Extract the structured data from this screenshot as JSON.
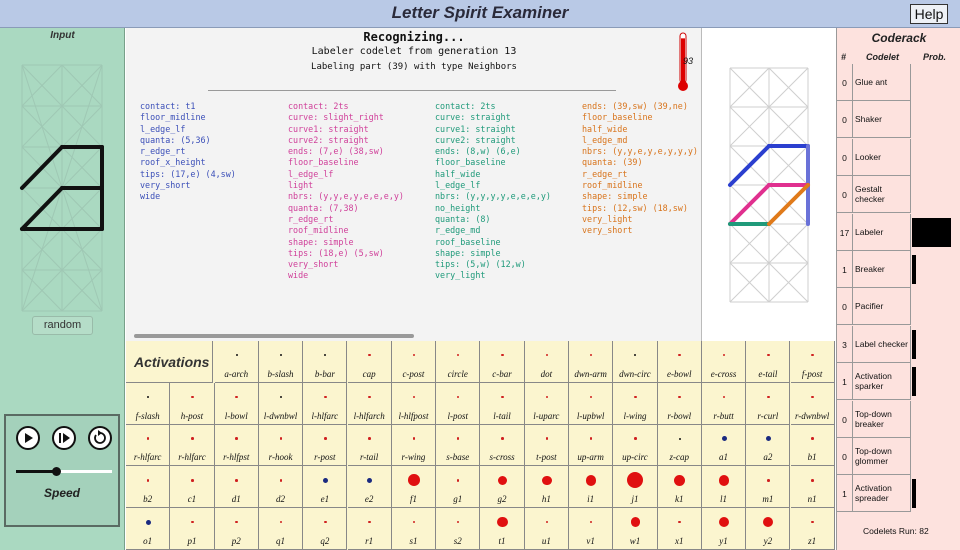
{
  "app": {
    "title": "Letter Spirit Examiner",
    "help_label": "Help"
  },
  "input_panel": {
    "header": "Input",
    "random_label": "random",
    "speed_label": "Speed",
    "speed_value": 0.42
  },
  "controls": {
    "play": "play-icon",
    "step": "step-icon",
    "reset": "reset-icon"
  },
  "recognition": {
    "title": "Recognizing...",
    "sub1": "Labeler codelet from generation 13",
    "sub2": "Labeling part (39) with type Neighbors",
    "temperature": "93",
    "temperature_level": 0.93,
    "columns": [
      {
        "color": "#3b4fb8",
        "lines": [
          "contact: t1",
          "floor_midline",
          "l_edge_lf",
          "quanta: (5,36)",
          "r_edge_rt",
          "roof_x_height",
          "tips: (17,e) (4,sw)",
          "very_short",
          "wide"
        ]
      },
      {
        "color": "#d0409a",
        "lines": [
          "contact: 2ts",
          "curve: slight_right",
          "curve1: straight",
          "curve2: straight",
          "ends: (7,e) (38,sw)",
          "floor_baseline",
          "l_edge_lf",
          "light",
          "nbrs: (y,y,e,y,e,e,e,y)",
          "quanta: (7,38)",
          "r_edge_rt",
          "roof_midline",
          "shape: simple",
          "tips: (18,e) (5,sw)",
          "very_short",
          "wide"
        ]
      },
      {
        "color": "#1f9a7a",
        "lines": [
          "contact: 2ts",
          "curve: straight",
          "curve1: straight",
          "curve2: straight",
          "ends: (8,w) (6,e)",
          "floor_baseline",
          "half_wide",
          "l_edge_lf",
          "nbrs: (y,y,y,y,e,e,e,y)",
          "no_height",
          "quanta: (8)",
          "r_edge_md",
          "roof_baseline",
          "shape: simple",
          "tips: (5,w) (12,w)",
          "very_light"
        ]
      },
      {
        "color": "#d8731a",
        "lines": [
          "ends: (39,sw) (39,ne)",
          "floor_baseline",
          "half_wide",
          "l_edge_md",
          "nbrs: (y,y,e,y,e,y,y,y)",
          "quanta: (39)",
          "r_edge_rt",
          "roof_midline",
          "shape: simple",
          "tips: (12,sw) (18,sw)",
          "very_light",
          "very_short"
        ]
      }
    ]
  },
  "activations": {
    "header": "Activations",
    "rows": [
      [
        {
          "label": "a-arch",
          "a": 0
        },
        {
          "label": "b-slash",
          "a": 0
        },
        {
          "label": "b-bar",
          "a": 0
        },
        {
          "label": "cap",
          "a": 0.1
        },
        {
          "label": "c-post",
          "a": 0.1
        },
        {
          "label": "circle",
          "a": 0.1
        },
        {
          "label": "c-bar",
          "a": 0.1
        },
        {
          "label": "dot",
          "a": 0.1
        },
        {
          "label": "dwn-arm",
          "a": 0.1
        },
        {
          "label": "dwn-circ",
          "a": 0
        },
        {
          "label": "e-bowl",
          "a": 0.1
        },
        {
          "label": "e-cross",
          "a": 0.1
        },
        {
          "label": "e-tail",
          "a": 0.1
        },
        {
          "label": "f-post",
          "a": 0.1
        }
      ],
      [
        {
          "label": "f-slash",
          "a": 0
        },
        {
          "label": "h-post",
          "a": 0.1
        },
        {
          "label": "l-bowl",
          "a": 0.1
        },
        {
          "label": "l-dwnbwl",
          "a": 0
        },
        {
          "label": "l-hlfarc",
          "a": 0.1
        },
        {
          "label": "l-hlfarch",
          "a": 0.1
        },
        {
          "label": "l-hlfpost",
          "a": 0.1
        },
        {
          "label": "l-post",
          "a": 0.1
        },
        {
          "label": "l-tail",
          "a": 0.1
        },
        {
          "label": "l-uparc",
          "a": 0.1
        },
        {
          "label": "l-upbwl",
          "a": 0.1
        },
        {
          "label": "l-wing",
          "a": 0.1
        },
        {
          "label": "r-bowl",
          "a": 0.1
        },
        {
          "label": "r-butt",
          "a": 0.1
        },
        {
          "label": "r-curl",
          "a": 0.1
        },
        {
          "label": "r-dwnbwl",
          "a": 0.1
        }
      ],
      [
        {
          "label": "r-hlfarc",
          "a": 0.1
        },
        {
          "label": "r-hlfarc",
          "a": 0.1
        },
        {
          "label": "r-hlfpst",
          "a": 0.1
        },
        {
          "label": "r-hook",
          "a": 0.1
        },
        {
          "label": "r-post",
          "a": 0.1
        },
        {
          "label": "r-tail",
          "a": 0.1
        },
        {
          "label": "r-wing",
          "a": 0.1
        },
        {
          "label": "s-base",
          "a": 0.1
        },
        {
          "label": "s-cross",
          "a": 0.1
        },
        {
          "label": "t-post",
          "a": 0.1
        },
        {
          "label": "up-arm",
          "a": 0.1
        },
        {
          "label": "up-circ",
          "a": 0.1
        },
        {
          "label": "z-cap",
          "a": 0
        },
        {
          "label": "a1",
          "a": 0.4
        },
        {
          "label": "a2",
          "a": 0.4
        },
        {
          "label": "b1",
          "a": 0.1
        }
      ],
      [
        {
          "label": "b2",
          "a": 0.1
        },
        {
          "label": "c1",
          "a": 0.1
        },
        {
          "label": "d1",
          "a": 0.1
        },
        {
          "label": "d2",
          "a": 0.1
        },
        {
          "label": "e1",
          "a": 0.4
        },
        {
          "label": "e2",
          "a": 0.4
        },
        {
          "label": "f1",
          "a": 0.65
        },
        {
          "label": "g1",
          "a": 0.1
        },
        {
          "label": "g2",
          "a": 0.45
        },
        {
          "label": "h1",
          "a": 0.45
        },
        {
          "label": "i1",
          "a": 0.55
        },
        {
          "label": "j1",
          "a": 1.0
        },
        {
          "label": "k1",
          "a": 0.6
        },
        {
          "label": "l1",
          "a": 0.55
        },
        {
          "label": "m1",
          "a": 0.1
        },
        {
          "label": "n1",
          "a": 0.1
        }
      ],
      [
        {
          "label": "o1",
          "a": 0.4
        },
        {
          "label": "p1",
          "a": 0.1
        },
        {
          "label": "p2",
          "a": 0.1
        },
        {
          "label": "q1",
          "a": 0.1
        },
        {
          "label": "q2",
          "a": 0.1
        },
        {
          "label": "r1",
          "a": 0.1
        },
        {
          "label": "s1",
          "a": 0.1
        },
        {
          "label": "s2",
          "a": 0.1
        },
        {
          "label": "t1",
          "a": 0.55
        },
        {
          "label": "u1",
          "a": 0.1
        },
        {
          "label": "v1",
          "a": 0.1
        },
        {
          "label": "w1",
          "a": 0.45
        },
        {
          "label": "x1",
          "a": 0.1
        },
        {
          "label": "y1",
          "a": 0.5
        },
        {
          "label": "y2",
          "a": 0.5
        },
        {
          "label": "z1",
          "a": 0.1
        }
      ]
    ]
  },
  "coderack": {
    "title": "Coderack",
    "col_num": "#",
    "col_codelet": "Codelet",
    "col_prob": "Prob.",
    "rows": [
      {
        "n": "0",
        "name": "Glue ant",
        "prob": 0
      },
      {
        "n": "0",
        "name": "Shaker",
        "prob": 0
      },
      {
        "n": "0",
        "name": "Looker",
        "prob": 0
      },
      {
        "n": "0",
        "name": "Gestalt checker",
        "prob": 0
      },
      {
        "n": "17",
        "name": "Labeler",
        "prob": 1.0
      },
      {
        "n": "1",
        "name": "Breaker",
        "prob": 0.1
      },
      {
        "n": "0",
        "name": "Pacifier",
        "prob": 0
      },
      {
        "n": "3",
        "name": "Label checker",
        "prob": 0.18
      },
      {
        "n": "1",
        "name": "Activation sparker",
        "prob": 0.1
      },
      {
        "n": "0",
        "name": "Top-down breaker",
        "prob": 0
      },
      {
        "n": "0",
        "name": "Top-down glommer",
        "prob": 0
      },
      {
        "n": "1",
        "name": "Activation spreader",
        "prob": 0.1
      }
    ],
    "codelets_run": "Codelets Run:  82"
  }
}
